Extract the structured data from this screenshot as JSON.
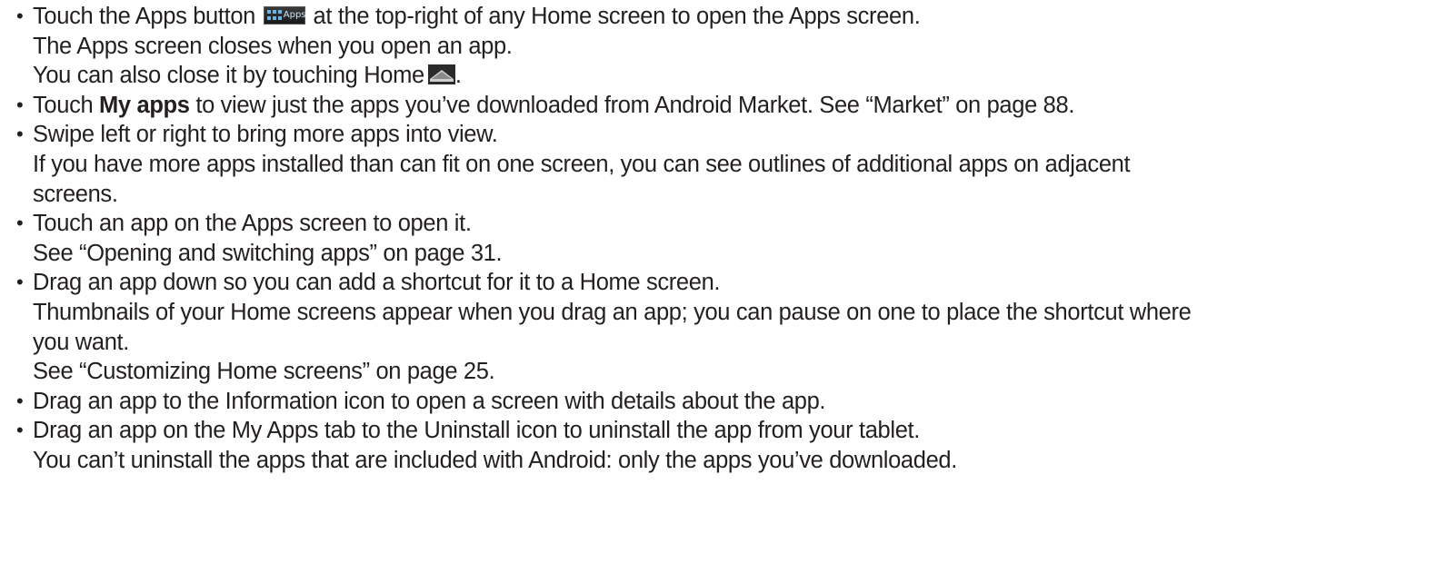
{
  "icons": {
    "apps_button": "apps-grid-icon",
    "apps_button_text": "Apps",
    "home_button": "home-icon"
  },
  "bullets": [
    {
      "lines": [
        {
          "before_icon": "Touch the Apps button",
          "after_icon": "at the top-right of any Home screen to open the Apps screen."
        },
        {
          "text": "The Apps screen closes when you open an app."
        },
        {
          "before_icon": "You can also close it by touching Home",
          "after_icon": "."
        }
      ]
    },
    {
      "lines": [
        {
          "prefix": "Touch ",
          "bold": "My apps",
          "suffix": " to view just the apps you’ve downloaded from Android Market. See “Market” on page 88."
        }
      ]
    },
    {
      "lines": [
        {
          "text": "Swipe left or right to bring more apps into view."
        },
        {
          "text": "If you have more apps installed than can fit on one screen, you can see outlines of additional apps on adjacent"
        },
        {
          "text": "screens."
        }
      ]
    },
    {
      "lines": [
        {
          "text": "Touch an app on the Apps screen to open it."
        },
        {
          "text": "See “Opening and switching apps” on page 31."
        }
      ]
    },
    {
      "lines": [
        {
          "text": "Drag an app down so you can add a shortcut for it to a Home screen."
        },
        {
          "text": "Thumbnails of your Home screens appear when you drag an app; you can pause on one to place the shortcut where"
        },
        {
          "text": "you want."
        },
        {
          "text": "See “Customizing Home screens” on page 25."
        }
      ]
    },
    {
      "lines": [
        {
          "text": "Drag an app to the Information icon to open a screen with details about the app."
        }
      ]
    },
    {
      "lines": [
        {
          "text": "Drag an app on the My Apps tab to the Uninstall icon to uninstall the app from your tablet."
        },
        {
          "text": "You can’t uninstall the apps that are included with Android: only the apps you’ve downloaded."
        }
      ]
    }
  ]
}
